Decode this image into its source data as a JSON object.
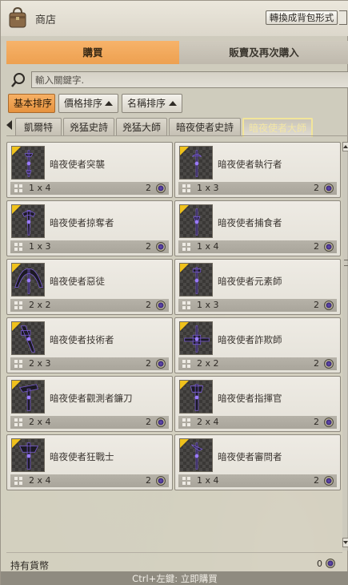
{
  "window": {
    "title": "商店",
    "convert_button": "轉換成背包形式"
  },
  "main_tabs": {
    "buy": "購買",
    "sell": "販賣及再次購入"
  },
  "search": {
    "placeholder": "輸入關鍵字."
  },
  "sort": {
    "basic": "基本排序",
    "price": "價格排序",
    "name": "名稱排序"
  },
  "category_tabs": [
    "凱爾特",
    "兇猛史詩",
    "兇猛大師",
    "暗夜使者史詩",
    "暗夜使者大師"
  ],
  "active_category": "暗夜使者大師",
  "items": [
    {
      "name": "暗夜使者突襲",
      "size": "1 x 4",
      "price": "2"
    },
    {
      "name": "暗夜使者執行者",
      "size": "1 x 3",
      "price": "2"
    },
    {
      "name": "暗夜使者掠奪者",
      "size": "1 x 3",
      "price": "2"
    },
    {
      "name": "暗夜使者捕食者",
      "size": "1 x 4",
      "price": "2"
    },
    {
      "name": "暗夜使者惡徒",
      "size": "2 x 2",
      "price": "2"
    },
    {
      "name": "暗夜使者元素師",
      "size": "1 x 3",
      "price": "2"
    },
    {
      "name": "暗夜使者技術者",
      "size": "2 x 3",
      "price": "2"
    },
    {
      "name": "暗夜使者詐欺師",
      "size": "2 x 2",
      "price": "2"
    },
    {
      "name": "暗夜使者觀測者鐮刀",
      "size": "2 x 4",
      "price": "2"
    },
    {
      "name": "暗夜使者指揮官",
      "size": "2 x 4",
      "price": "2"
    },
    {
      "name": "暗夜使者狂戰士",
      "size": "2 x 4",
      "price": "2"
    },
    {
      "name": "暗夜使者審問者",
      "size": "1 x 4",
      "price": "2"
    }
  ],
  "footer": {
    "currency_label": "持有貨幣",
    "currency_value": "0",
    "hint": "Ctrl+左鍵: 立即購買"
  },
  "colors": {
    "accent_orange": "#eda050",
    "active_tab_border": "#f2e59a",
    "premium_corner": "#f0c21c"
  }
}
